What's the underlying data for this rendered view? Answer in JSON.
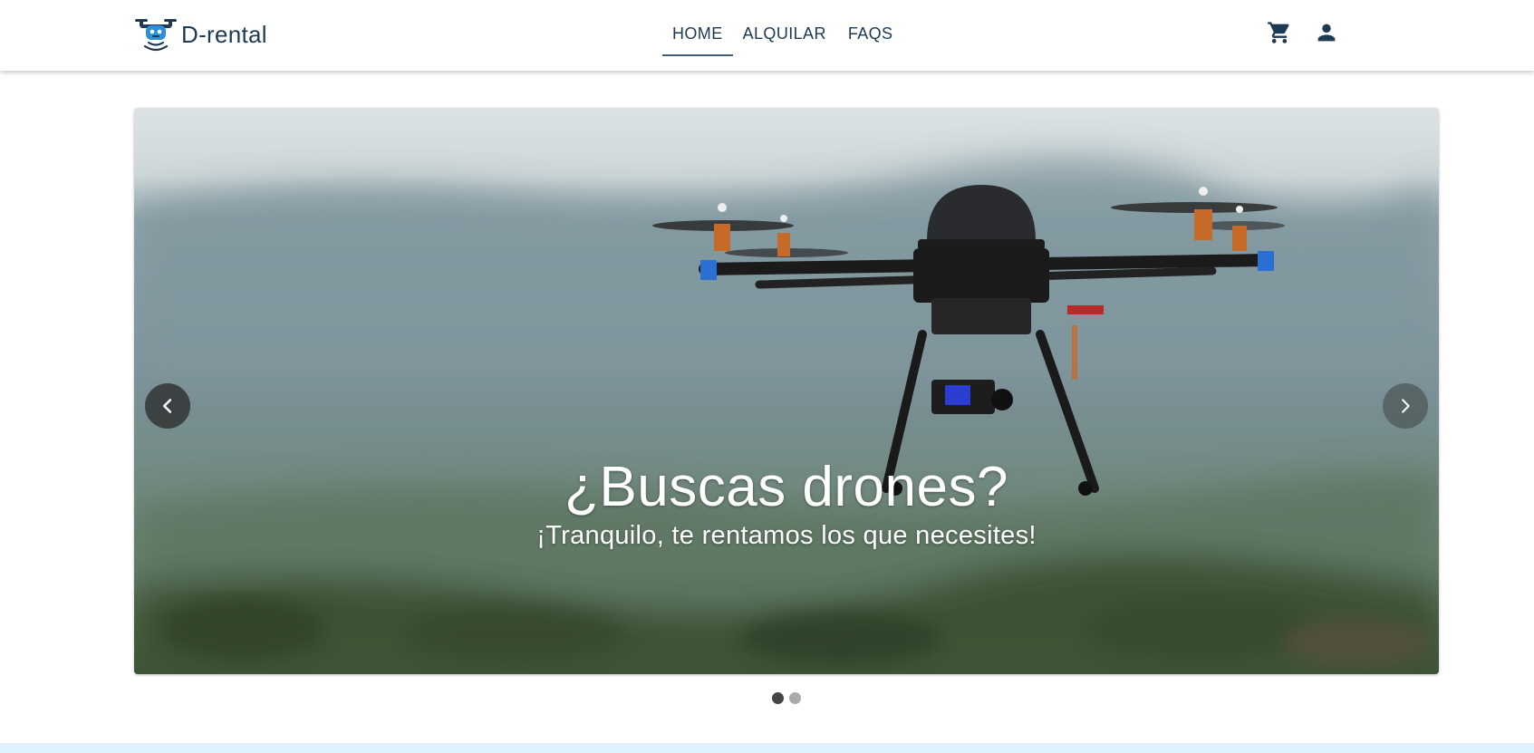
{
  "brand": {
    "name": "D-rental",
    "logo_icon": "drone-logo-icon"
  },
  "nav": {
    "tabs": [
      {
        "label": "HOME",
        "active": true
      },
      {
        "label": "ALQUILAR",
        "active": false
      },
      {
        "label": "FAQS",
        "active": false
      }
    ]
  },
  "actions": {
    "cart_icon": "shopping-cart-icon",
    "account_icon": "user-icon"
  },
  "carousel": {
    "title": "¿Buscas drones?",
    "subtitle": "¡Tranquilo, te rentamos los que necesites!",
    "slide_count": 2,
    "active_slide": 1,
    "prev_icon": "chevron-left-icon",
    "next_icon": "chevron-right-icon"
  },
  "colors": {
    "brand_text": "#1e3a52",
    "logo_blue": "#2d8fd6",
    "bottom_band": "#dff1fb"
  }
}
